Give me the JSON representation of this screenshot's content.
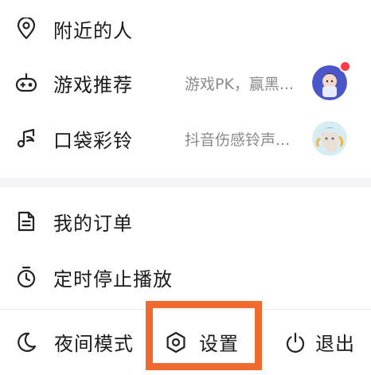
{
  "menu": {
    "items": [
      {
        "label": "附近的人",
        "icon": "location-pin-icon"
      },
      {
        "label": "游戏推荐",
        "icon": "game-controller-icon",
        "desc": "游戏PK，赢黑...",
        "badge_color": "#ff3b47"
      },
      {
        "label": "口袋彩铃",
        "icon": "music-note-icon",
        "desc": "抖音伤感铃声..."
      },
      {
        "label": "我的订单",
        "icon": "document-icon"
      },
      {
        "label": "定时停止播放",
        "icon": "timer-icon"
      }
    ]
  },
  "bottom_bar": {
    "night_mode_label": "夜间模式",
    "settings_label": "设置",
    "exit_label": "退出"
  },
  "colors": {
    "highlight": "#f06a2f",
    "badge": "#ff3b47",
    "text": "#1a1a1a",
    "secondary_text": "#8a8a8a"
  }
}
